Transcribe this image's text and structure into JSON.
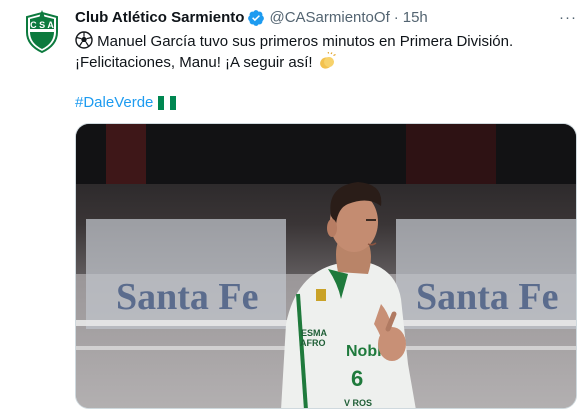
{
  "account": {
    "name": "Club Atlético Sarmiento",
    "handle": "@CASarmientoOf",
    "separator": "·",
    "time": "15h",
    "verified_icon": "verified-badge-icon",
    "avatar_text": "C S A"
  },
  "tweet": {
    "line1": "Manuel García tuvo sus primeros minutos en Primera División.",
    "line2": "¡Felicitaciones, Manu! ¡A seguir así!",
    "hashtag": "#DaleVerde",
    "icons": [
      "soccer-ball-icon",
      "clapping-hands-icon",
      "nigeria-flag-icon"
    ]
  },
  "media": {
    "banner_text_left": "Santa Fe",
    "banner_text_right": "Santa Fe",
    "jersey_text_1": "ESMA",
    "jersey_text_2": "AFRO",
    "jersey_text_3": "Nobl",
    "jersey_text_4": "6",
    "jersey_text_5": "V ROS"
  },
  "colors": {
    "link": "#1d9bf0",
    "verified": "#1d9bf0",
    "secondary_text": "#536471",
    "club_green": "#0c7a3e"
  }
}
